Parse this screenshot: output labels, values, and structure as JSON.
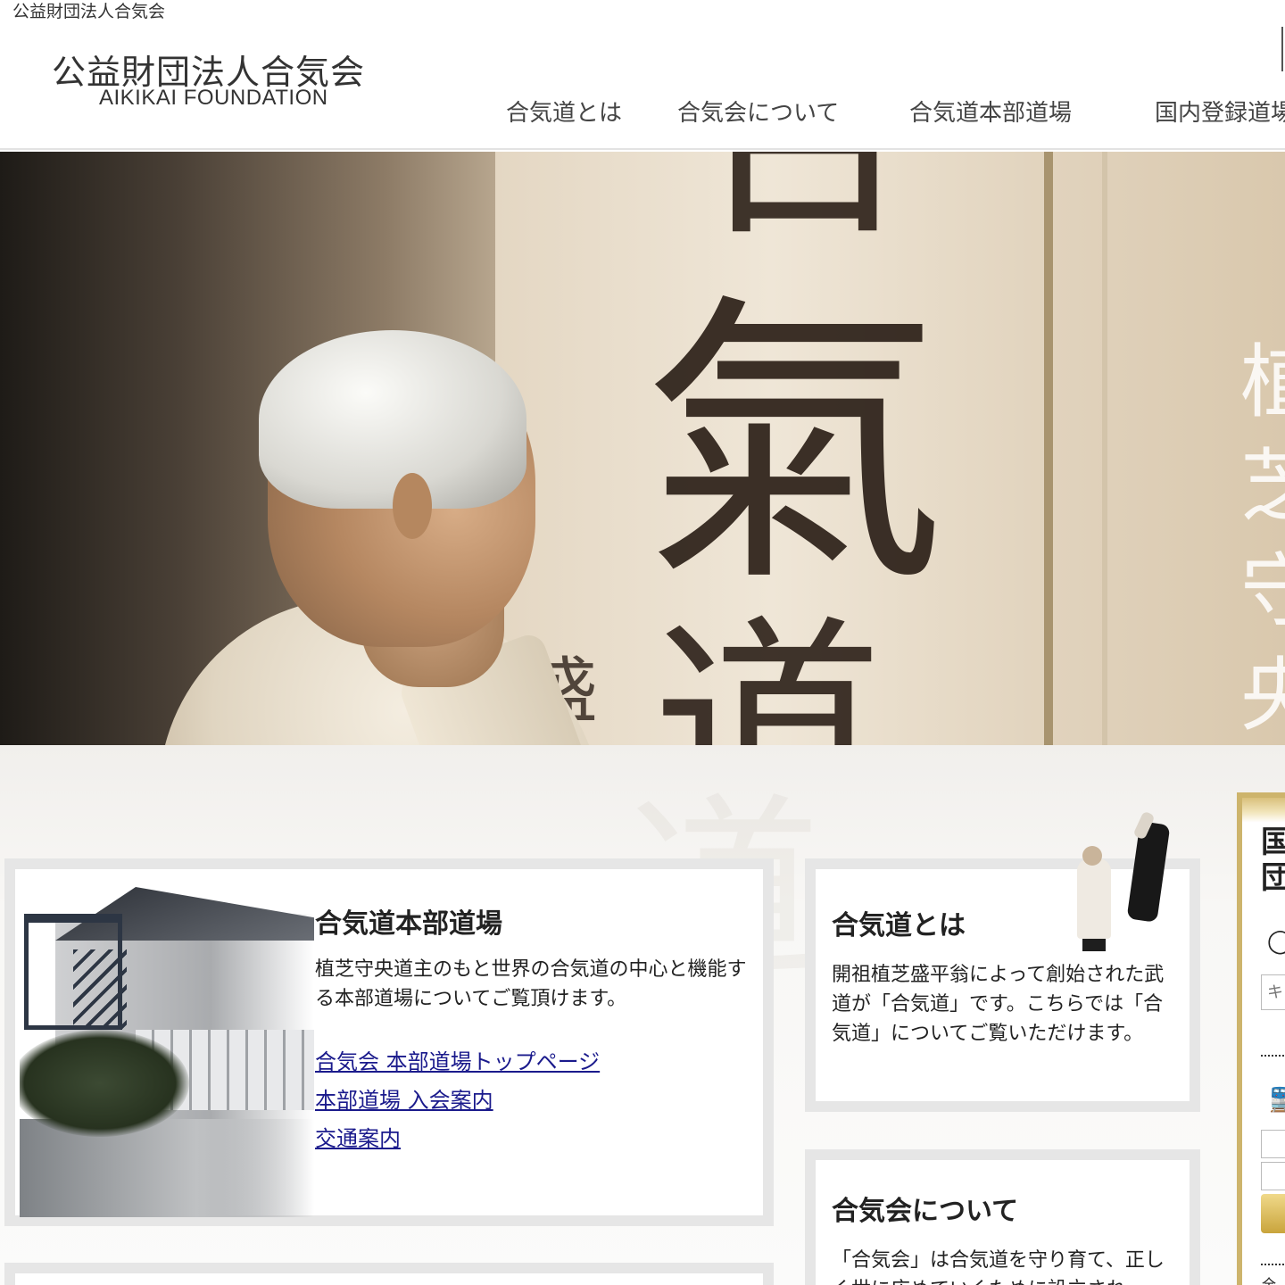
{
  "top_strip": "公益財団法人合気会",
  "logo": {
    "jp": "公益財団法人合気会",
    "en": "AIKIKAI FOUNDATION"
  },
  "nav": [
    {
      "label": "合気道とは"
    },
    {
      "label": "合気会について"
    },
    {
      "label": "合気道本部道場"
    },
    {
      "label": "国内登録道場"
    }
  ],
  "hero": {
    "calligraphy_big": "氣",
    "calligraphy_top": "合",
    "calligraphy_bottom": "道",
    "signature": "盛",
    "vertical_text": "植芝守央"
  },
  "cards": {
    "honbu": {
      "title": "合気道本部道場",
      "text": "植芝守央道主のもと世界の合気道の中心と機能する本部道場についてご覧頂けます。",
      "links": [
        "合気会 本部道場トップページ",
        "本部道場 入会案内",
        "交通案内"
      ]
    },
    "aikido": {
      "title": "合気道とは",
      "text": "開祖植芝盛平翁によって創始された武道が「合気道」です。こちらでは「合気道」についてご覧いただけます。"
    },
    "aikikai": {
      "title": "合気会について",
      "text": "「合気会」は合気道を守り育て、正しく世に広めていくために設立され"
    }
  },
  "sidebar": {
    "title": "国団",
    "search_icon": "search-icon",
    "search_placeholder": "キ",
    "train_icon": "train-icon",
    "footer_text": "全国"
  },
  "colors": {
    "link": "#1a1a8c",
    "gold": "#cdb46c",
    "card_border": "#e6e6e6"
  }
}
